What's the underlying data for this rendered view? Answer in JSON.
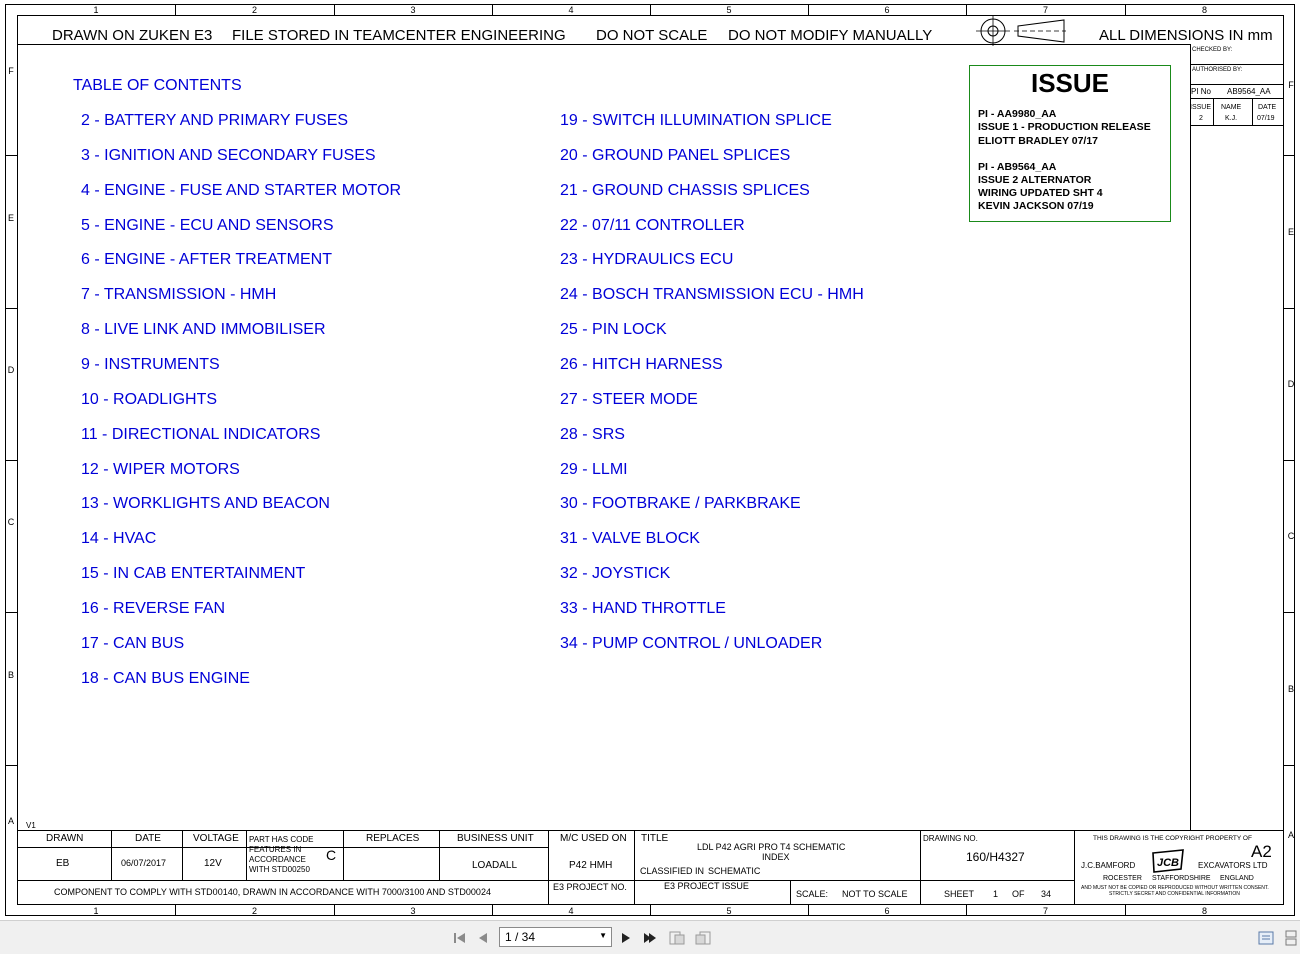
{
  "header": {
    "drawn_on": "DRAWN ON ZUKEN E3",
    "file_stored": "FILE STORED IN TEAMCENTER ENGINEERING",
    "do_not_scale": "DO NOT SCALE",
    "do_not_modify": "DO NOT MODIFY MANUALLY",
    "dimensions": "ALL DIMENSIONS IN mm"
  },
  "zones": {
    "columns": [
      "1",
      "2",
      "3",
      "4",
      "5",
      "6",
      "7",
      "8"
    ],
    "rows": [
      "F",
      "E",
      "D",
      "C",
      "B",
      "A"
    ]
  },
  "toc": {
    "title": "TABLE OF CONTENTS",
    "left": [
      {
        "num": "2",
        "label": "BATTERY AND PRIMARY FUSES"
      },
      {
        "num": "3",
        "label": "IGNITION AND SECONDARY FUSES"
      },
      {
        "num": "4",
        "label": "ENGINE - FUSE AND STARTER MOTOR"
      },
      {
        "num": "5",
        "label": "ENGINE - ECU AND SENSORS"
      },
      {
        "num": "6",
        "label": "ENGINE - AFTER TREATMENT"
      },
      {
        "num": "7",
        "label": "TRANSMISSION - HMH"
      },
      {
        "num": "8",
        "label": "LIVE LINK AND IMMOBILISER"
      },
      {
        "num": "9",
        "label": "INSTRUMENTS"
      },
      {
        "num": "10",
        "label": "ROADLIGHTS"
      },
      {
        "num": "11",
        "label": "DIRECTIONAL INDICATORS"
      },
      {
        "num": "12",
        "label": "WIPER MOTORS"
      },
      {
        "num": "13",
        "label": "WORKLIGHTS AND BEACON"
      },
      {
        "num": "14",
        "label": "HVAC"
      },
      {
        "num": "15",
        "label": "IN CAB ENTERTAINMENT"
      },
      {
        "num": "16",
        "label": "REVERSE FAN"
      },
      {
        "num": "17",
        "label": "CAN BUS"
      },
      {
        "num": "18",
        "label": "CAN BUS ENGINE"
      }
    ],
    "right": [
      {
        "num": "19",
        "label": "SWITCH ILLUMINATION SPLICE"
      },
      {
        "num": "20",
        "label": "GROUND PANEL SPLICES"
      },
      {
        "num": "21",
        "label": "GROUND CHASSIS SPLICES"
      },
      {
        "num": "22",
        "label": "07/11 CONTROLLER"
      },
      {
        "num": "23",
        "label": "HYDRAULICS ECU"
      },
      {
        "num": "24",
        "label": "BOSCH TRANSMISSION ECU - HMH"
      },
      {
        "num": "25",
        "label": "PIN LOCK"
      },
      {
        "num": "26",
        "label": "HITCH HARNESS"
      },
      {
        "num": "27",
        "label": "STEER MODE"
      },
      {
        "num": "28",
        "label": "SRS"
      },
      {
        "num": "29",
        "label": "LLMI"
      },
      {
        "num": "30",
        "label": "FOOTBRAKE / PARKBRAKE"
      },
      {
        "num": "31",
        "label": "VALVE BLOCK"
      },
      {
        "num": "32",
        "label": "JOYSTICK"
      },
      {
        "num": "33",
        "label": "HAND THROTTLE"
      },
      {
        "num": "34",
        "label": "PUMP CONTROL / UNLOADER"
      }
    ]
  },
  "issue_box": {
    "title": "ISSUE",
    "lines": [
      "PI - AA9980_AA",
      "ISSUE 1 - PRODUCTION RELEASE",
      "ELIOTT BRADLEY 07/17",
      "PI - AB9564_AA",
      "ISSUE 2 ALTERNATOR",
      "WIRING UPDATED SHT 4",
      "KEVIN JACKSON 07/19"
    ]
  },
  "revision_block": {
    "checked_by": "CHECKED BY:",
    "authorised_by": "AUTHORISED BY:",
    "pi_no_label": "PI No",
    "pi_no_value": "AB9564_AA",
    "issue_label": "ISSUE",
    "name_label": "NAME",
    "date_label": "DATE",
    "issue_value": "2",
    "name_value": "K.J.",
    "date_value": "07/19"
  },
  "title_block": {
    "version": "V1",
    "drawn_label": "DRAWN",
    "drawn_value": "EB",
    "date_label": "DATE",
    "date_value": "06/07/2017",
    "voltage_label": "VOLTAGE",
    "voltage_value": "12V",
    "part_code_lines": [
      "PART HAS CODE",
      "FEATURES IN",
      "ACCORDANCE",
      "WITH STD00250"
    ],
    "part_code_value": "C",
    "replaces_label": "REPLACES",
    "business_unit_label": "BUSINESS UNIT",
    "business_unit_value": "LOADALL",
    "mc_used_on_label": "M/C USED ON",
    "mc_used_on_value": "P42 HMH",
    "compliance": "COMPONENT TO COMPLY WITH STD00140, DRAWN IN ACCORDANCE WITH 7000/3100 AND STD00024",
    "e3_project_no_label": "E3 PROJECT NO.",
    "title_label": "TITLE",
    "title_value_1": "LDL P42 AGRI PRO T4 SCHEMATIC",
    "title_value_2": "INDEX",
    "classified_label": "CLASSIFIED IN",
    "classified_value": "SCHEMATIC",
    "e3_project_issue_label": "E3 PROJECT ISSUE",
    "scale_label": "SCALE:",
    "scale_value": "NOT TO SCALE",
    "drawing_no_label": "DRAWING NO.",
    "drawing_no_value": "160/H4327",
    "sheet_label": "SHEET",
    "sheet_value": "1",
    "of_label": "OF",
    "of_value": "34",
    "copyright": "THIS DRAWING IS THE COPYRIGHT PROPERTY OF",
    "size": "A2",
    "company_left": "J.C.BAMFORD",
    "company_right": "EXCAVATORS LTD",
    "loc_1": "ROCESTER",
    "loc_2": "STAFFORDSHIRE",
    "loc_3": "ENGLAND",
    "notice_1": "AND MUST NOT BE COPIED OR REPRODUCED WITHOUT WRITTEN CONSENT.",
    "notice_2": "STRICTLY SECRET AND CONFIDENTIAL INFORMATION",
    "logo_text": "JCB"
  },
  "viewer": {
    "page_indicator": "1 / 34"
  }
}
